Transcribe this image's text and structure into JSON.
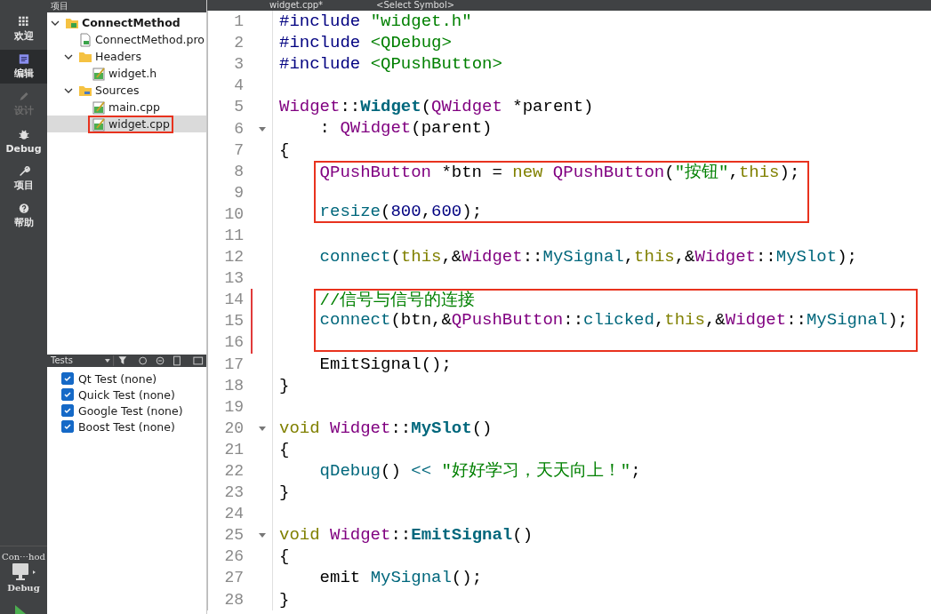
{
  "modes": [
    {
      "label": "欢迎",
      "kind": "grid",
      "selected": false,
      "disabled": false
    },
    {
      "label": "编辑",
      "kind": "edit",
      "selected": true,
      "disabled": false
    },
    {
      "label": "设计",
      "kind": "pencil",
      "selected": false,
      "disabled": true
    },
    {
      "label": "Debug",
      "kind": "bug",
      "selected": false,
      "disabled": false
    },
    {
      "label": "项目",
      "kind": "wrench",
      "selected": false,
      "disabled": false
    },
    {
      "label": "帮助",
      "kind": "help",
      "selected": false,
      "disabled": false
    }
  ],
  "target": {
    "project": "Con⋯hod",
    "build": "Debug"
  },
  "project_panel": {
    "title": "项目",
    "tree": [
      {
        "label": "ConnectMethod",
        "kind": "project",
        "expanded": true,
        "selected": false,
        "annotated": false,
        "children": [
          {
            "label": "ConnectMethod.pro",
            "kind": "profile",
            "selected": false,
            "annotated": false
          },
          {
            "label": "Headers",
            "kind": "hfolder",
            "expanded": true,
            "selected": false,
            "annotated": false,
            "children": [
              {
                "label": "widget.h",
                "kind": "file",
                "selected": false,
                "annotated": false
              }
            ]
          },
          {
            "label": "Sources",
            "kind": "cfolder",
            "expanded": true,
            "selected": false,
            "annotated": false,
            "children": [
              {
                "label": "main.cpp",
                "kind": "file",
                "selected": false,
                "annotated": false
              },
              {
                "label": "widget.cpp",
                "kind": "file",
                "selected": true,
                "annotated": true
              }
            ]
          }
        ]
      }
    ]
  },
  "tests_panel": {
    "title": "Tests",
    "items": [
      {
        "label": "Qt Test (none)",
        "checked": true
      },
      {
        "label": "Quick Test (none)",
        "checked": true
      },
      {
        "label": "Google Test (none)",
        "checked": true
      },
      {
        "label": "Boost Test (none)",
        "checked": true
      }
    ]
  },
  "editor": {
    "tab": "widget.cpp*",
    "symbol_selector": "<Select Symbol>",
    "blocks": [
      {
        "boxed": false,
        "lines": [
          {
            "n": "1",
            "foldable": false,
            "changed": false,
            "tokens": [
              {
                "kind": "pp",
                "text": "#include "
              },
              {
                "kind": "str",
                "text": "\"widget.h\""
              }
            ]
          },
          {
            "n": "2",
            "foldable": false,
            "changed": false,
            "tokens": [
              {
                "kind": "pp",
                "text": "#include "
              },
              {
                "kind": "str",
                "text": "<QDebug>"
              }
            ]
          },
          {
            "n": "3",
            "foldable": false,
            "changed": false,
            "tokens": [
              {
                "kind": "pp",
                "text": "#include "
              },
              {
                "kind": "str",
                "text": "<QPushButton>"
              }
            ]
          },
          {
            "n": "4",
            "foldable": false,
            "changed": false
          },
          {
            "n": "5",
            "foldable": false,
            "changed": false,
            "tokens": [
              {
                "kind": "type",
                "text": "Widget"
              },
              {
                "kind": "plain",
                "text": "::"
              },
              {
                "kind": "decl",
                "text": "Widget"
              },
              {
                "kind": "plain",
                "text": "("
              },
              {
                "kind": "type",
                "text": "QWidget"
              },
              {
                "kind": "plain",
                "text": " *parent)"
              }
            ]
          },
          {
            "n": "6",
            "foldable": true,
            "changed": false,
            "tokens": [
              {
                "kind": "plain",
                "text": "    : "
              },
              {
                "kind": "type",
                "text": "QWidget"
              },
              {
                "kind": "plain",
                "text": "(parent)"
              }
            ]
          },
          {
            "n": "7",
            "foldable": false,
            "changed": false,
            "tokens": [
              {
                "kind": "plain",
                "text": "{"
              }
            ]
          }
        ]
      },
      {
        "boxed": true,
        "lines": [
          {
            "n": "8",
            "foldable": false,
            "changed": false,
            "tokens": [
              {
                "kind": "type",
                "text": "QPushButton"
              },
              {
                "kind": "plain",
                "text": " *btn = "
              },
              {
                "kind": "kw",
                "text": "new "
              },
              {
                "kind": "type",
                "text": "QPushButton"
              },
              {
                "kind": "plain",
                "text": "("
              },
              {
                "kind": "str",
                "text": "\"按钮\""
              },
              {
                "kind": "plain",
                "text": ","
              },
              {
                "kind": "kw",
                "text": "this"
              },
              {
                "kind": "plain",
                "text": ");"
              }
            ]
          },
          {
            "n": "9",
            "foldable": false,
            "changed": false
          },
          {
            "n": "10",
            "foldable": false,
            "changed": false,
            "tokens": [
              {
                "kind": "call",
                "text": "resize"
              },
              {
                "kind": "plain",
                "text": "("
              },
              {
                "kind": "num",
                "text": "800"
              },
              {
                "kind": "plain",
                "text": ","
              },
              {
                "kind": "num",
                "text": "600"
              },
              {
                "kind": "plain",
                "text": ");"
              }
            ]
          }
        ]
      },
      {
        "boxed": false,
        "lines": [
          {
            "n": "11",
            "foldable": false,
            "changed": false
          },
          {
            "n": "12",
            "foldable": false,
            "changed": false,
            "tokens": [
              {
                "kind": "call",
                "text": "    connect"
              },
              {
                "kind": "plain",
                "text": "("
              },
              {
                "kind": "kw",
                "text": "this"
              },
              {
                "kind": "plain",
                "text": ",&"
              },
              {
                "kind": "type",
                "text": "Widget"
              },
              {
                "kind": "plain",
                "text": "::"
              },
              {
                "kind": "call",
                "text": "MySignal"
              },
              {
                "kind": "plain",
                "text": ","
              },
              {
                "kind": "kw",
                "text": "this"
              },
              {
                "kind": "plain",
                "text": ",&"
              },
              {
                "kind": "type",
                "text": "Widget"
              },
              {
                "kind": "plain",
                "text": "::"
              },
              {
                "kind": "call",
                "text": "MySlot"
              },
              {
                "kind": "plain",
                "text": ");"
              }
            ]
          },
          {
            "n": "13",
            "foldable": false,
            "changed": false
          }
        ]
      },
      {
        "boxed": true,
        "lines": [
          {
            "n": "14",
            "foldable": false,
            "changed": true,
            "tokens": [
              {
                "kind": "comment",
                "text": "//信号与信号的连接"
              }
            ]
          },
          {
            "n": "15",
            "foldable": false,
            "changed": true,
            "tokens": [
              {
                "kind": "call",
                "text": "connect"
              },
              {
                "kind": "plain",
                "text": "(btn,&"
              },
              {
                "kind": "type",
                "text": "QPushButton"
              },
              {
                "kind": "plain",
                "text": "::"
              },
              {
                "kind": "call",
                "text": "clicked"
              },
              {
                "kind": "plain",
                "text": ","
              },
              {
                "kind": "kw",
                "text": "this"
              },
              {
                "kind": "plain",
                "text": ",&"
              },
              {
                "kind": "type",
                "text": "Widget"
              },
              {
                "kind": "plain",
                "text": "::"
              },
              {
                "kind": "call",
                "text": "MySignal"
              },
              {
                "kind": "plain",
                "text": ");"
              }
            ]
          },
          {
            "n": "16",
            "foldable": false,
            "changed": true
          }
        ]
      },
      {
        "boxed": false,
        "lines": [
          {
            "n": "17",
            "foldable": false,
            "changed": false,
            "tokens": [
              {
                "kind": "plain",
                "text": "    EmitSignal();"
              }
            ]
          },
          {
            "n": "18",
            "foldable": false,
            "changed": false,
            "tokens": [
              {
                "kind": "plain",
                "text": "}"
              }
            ]
          },
          {
            "n": "19",
            "foldable": false,
            "changed": false
          },
          {
            "n": "20",
            "foldable": true,
            "changed": false,
            "tokens": [
              {
                "kind": "kw",
                "text": "void "
              },
              {
                "kind": "type",
                "text": "Widget"
              },
              {
                "kind": "plain",
                "text": "::"
              },
              {
                "kind": "decl",
                "text": "MySlot"
              },
              {
                "kind": "plain",
                "text": "()"
              }
            ]
          },
          {
            "n": "21",
            "foldable": false,
            "changed": false,
            "tokens": [
              {
                "kind": "plain",
                "text": "{"
              }
            ]
          },
          {
            "n": "22",
            "foldable": false,
            "changed": false,
            "tokens": [
              {
                "kind": "call",
                "text": "    qDebug"
              },
              {
                "kind": "plain",
                "text": "() "
              },
              {
                "kind": "call",
                "text": "<< "
              },
              {
                "kind": "str",
                "text": "\"好好学习，天天向上！\""
              },
              {
                "kind": "plain",
                "text": ";"
              }
            ]
          },
          {
            "n": "23",
            "foldable": false,
            "changed": false,
            "tokens": [
              {
                "kind": "plain",
                "text": "}"
              }
            ]
          },
          {
            "n": "24",
            "foldable": false,
            "changed": false
          },
          {
            "n": "25",
            "foldable": true,
            "changed": false,
            "tokens": [
              {
                "kind": "kw",
                "text": "void "
              },
              {
                "kind": "type",
                "text": "Widget"
              },
              {
                "kind": "plain",
                "text": "::"
              },
              {
                "kind": "decl",
                "text": "EmitSignal"
              },
              {
                "kind": "plain",
                "text": "()"
              }
            ]
          },
          {
            "n": "26",
            "foldable": false,
            "changed": false,
            "tokens": [
              {
                "kind": "plain",
                "text": "{"
              }
            ]
          },
          {
            "n": "27",
            "foldable": false,
            "changed": false,
            "tokens": [
              {
                "kind": "plain",
                "text": "    emit "
              },
              {
                "kind": "call",
                "text": "MySignal"
              },
              {
                "kind": "plain",
                "text": "();"
              }
            ]
          },
          {
            "n": "28",
            "foldable": false,
            "changed": false,
            "tokens": [
              {
                "kind": "plain",
                "text": "}"
              }
            ]
          }
        ]
      }
    ]
  }
}
